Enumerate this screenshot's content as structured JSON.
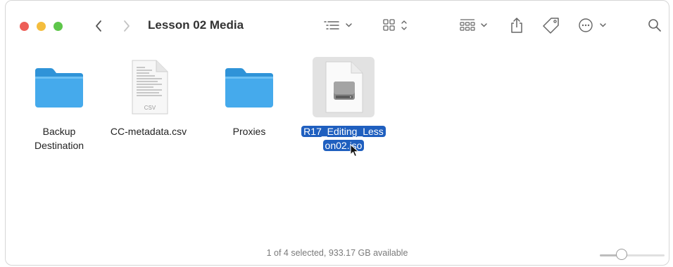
{
  "window": {
    "title": "Lesson 02 Media"
  },
  "items": [
    {
      "name_line1": "Backup",
      "name_line2": "Destination",
      "type": "folder",
      "selected": false
    },
    {
      "name_line1": "CC-metadata.csv",
      "name_line2": "",
      "type": "csv-file",
      "badge": "CSV",
      "selected": false
    },
    {
      "name_line1": "Proxies",
      "name_line2": "",
      "type": "folder",
      "selected": false
    },
    {
      "name_line1": "R17_Editing_Less",
      "name_line2": "on02.iso",
      "type": "disk-image",
      "selected": true
    }
  ],
  "status": {
    "text": "1 of 4 selected, 933.17 GB available"
  },
  "zoom_slider": {
    "value": 0.3
  },
  "colors": {
    "selection": "#1f5fbf",
    "folder": "#3aa3e6"
  }
}
